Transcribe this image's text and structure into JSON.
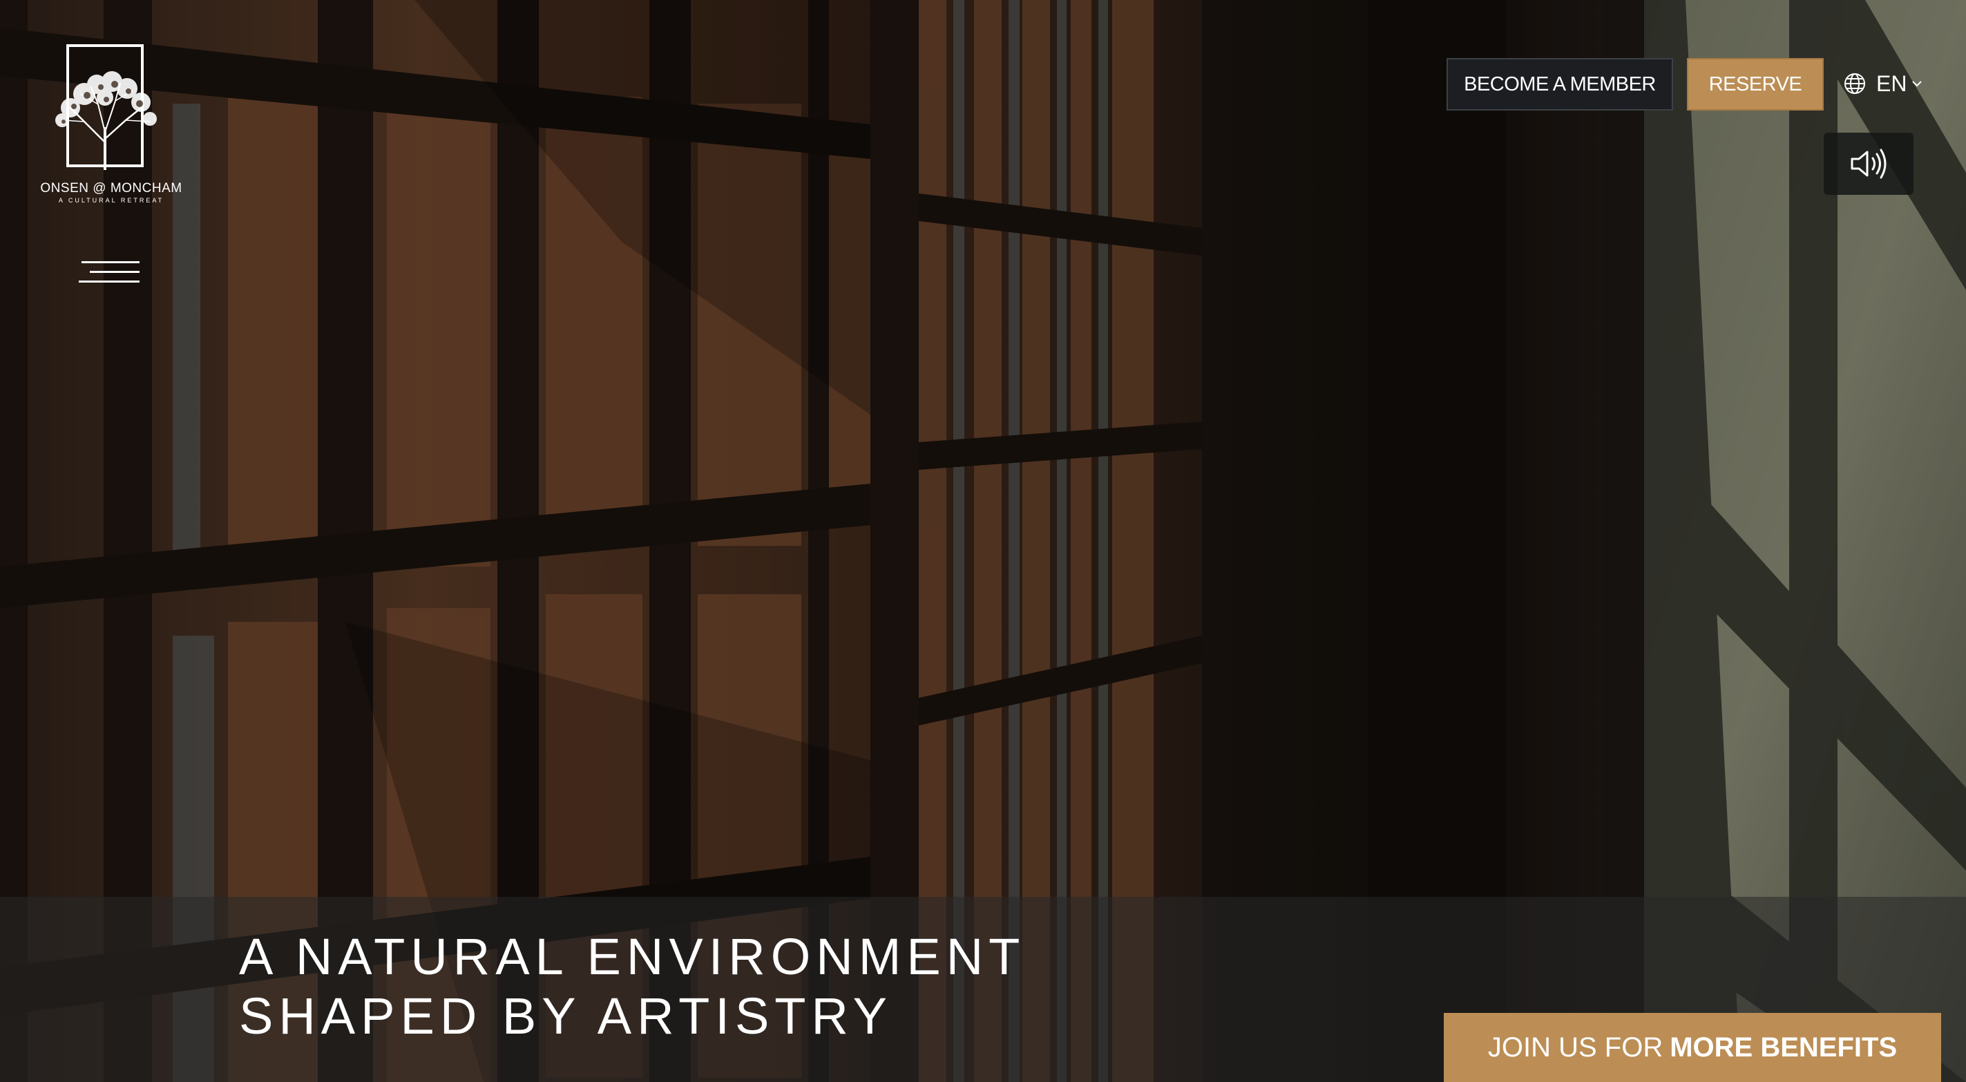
{
  "brand": {
    "name": "ONSEN @ MONCHAM",
    "tagline": "A CULTURAL RETREAT"
  },
  "header": {
    "menu_icon": "hamburger-menu-icon",
    "member_label": "BECOME A MEMBER",
    "reserve_label": "RESERVE",
    "language": "EN",
    "language_icon": "globe-icon",
    "sound_icon": "speaker-sound-icon"
  },
  "hero": {
    "headline_line1": "A NATURAL ENVIRONMENT",
    "headline_line2": "SHAPED BY ARTISTRY"
  },
  "cta": {
    "join_prefix": "JOIN US FOR",
    "join_emphasis": "MORE BENEFITS"
  },
  "colors": {
    "accent_gold": "#bc8e55",
    "dark_button": "#1c1e22"
  }
}
